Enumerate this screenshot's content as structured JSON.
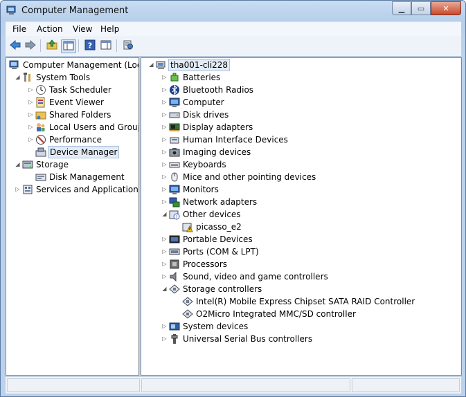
{
  "window": {
    "title": "Computer Management",
    "icon": "computer-management-icon"
  },
  "menu": [
    "File",
    "Action",
    "View",
    "Help"
  ],
  "toolbar": [
    "back-arrow-icon",
    "forward-arrow-icon",
    "up-folder-icon",
    "show-hide-tree-icon",
    "help-icon",
    "action-pane-icon",
    "properties-icon"
  ],
  "left_tree": [
    {
      "label": "Computer Management (Local",
      "icon": "computer-management-icon",
      "depth": 0,
      "expander": "none",
      "selected": false
    },
    {
      "label": "System Tools",
      "icon": "tools-icon",
      "depth": 1,
      "expander": "expanded",
      "selected": false
    },
    {
      "label": "Task Scheduler",
      "icon": "clock-icon",
      "depth": 2,
      "expander": "collapsed",
      "selected": false
    },
    {
      "label": "Event Viewer",
      "icon": "event-viewer-icon",
      "depth": 2,
      "expander": "collapsed",
      "selected": false
    },
    {
      "label": "Shared Folders",
      "icon": "shared-folder-icon",
      "depth": 2,
      "expander": "collapsed",
      "selected": false
    },
    {
      "label": "Local Users and Groups",
      "icon": "users-icon",
      "depth": 2,
      "expander": "collapsed",
      "selected": false
    },
    {
      "label": "Performance",
      "icon": "performance-icon",
      "depth": 2,
      "expander": "collapsed",
      "selected": false
    },
    {
      "label": "Device Manager",
      "icon": "device-manager-icon",
      "depth": 2,
      "expander": "none",
      "selected": true
    },
    {
      "label": "Storage",
      "icon": "storage-icon",
      "depth": 1,
      "expander": "expanded",
      "selected": false
    },
    {
      "label": "Disk Management",
      "icon": "disk-management-icon",
      "depth": 2,
      "expander": "none",
      "selected": false
    },
    {
      "label": "Services and Applications",
      "icon": "services-icon",
      "depth": 1,
      "expander": "collapsed",
      "selected": false
    }
  ],
  "device_tree": [
    {
      "label": "tha001-cli228",
      "icon": "computer-icon",
      "depth": 0,
      "expander": "expanded",
      "selected": true
    },
    {
      "label": "Batteries",
      "icon": "battery-icon",
      "depth": 1,
      "expander": "collapsed"
    },
    {
      "label": "Bluetooth Radios",
      "icon": "bluetooth-icon",
      "depth": 1,
      "expander": "collapsed"
    },
    {
      "label": "Computer",
      "icon": "monitor-icon",
      "depth": 1,
      "expander": "collapsed"
    },
    {
      "label": "Disk drives",
      "icon": "disk-drive-icon",
      "depth": 1,
      "expander": "collapsed"
    },
    {
      "label": "Display adapters",
      "icon": "display-adapter-icon",
      "depth": 1,
      "expander": "collapsed"
    },
    {
      "label": "Human Interface Devices",
      "icon": "hid-icon",
      "depth": 1,
      "expander": "collapsed"
    },
    {
      "label": "Imaging devices",
      "icon": "camera-icon",
      "depth": 1,
      "expander": "collapsed"
    },
    {
      "label": "Keyboards",
      "icon": "keyboard-icon",
      "depth": 1,
      "expander": "collapsed"
    },
    {
      "label": "Mice and other pointing devices",
      "icon": "mouse-icon",
      "depth": 1,
      "expander": "collapsed"
    },
    {
      "label": "Monitors",
      "icon": "monitor-icon",
      "depth": 1,
      "expander": "collapsed"
    },
    {
      "label": "Network adapters",
      "icon": "network-icon",
      "depth": 1,
      "expander": "collapsed"
    },
    {
      "label": "Other devices",
      "icon": "unknown-device-icon",
      "depth": 1,
      "expander": "expanded"
    },
    {
      "label": "picasso_e2",
      "icon": "warning-device-icon",
      "depth": 2,
      "expander": "none"
    },
    {
      "label": "Portable Devices",
      "icon": "portable-device-icon",
      "depth": 1,
      "expander": "collapsed"
    },
    {
      "label": "Ports (COM & LPT)",
      "icon": "port-icon",
      "depth": 1,
      "expander": "collapsed"
    },
    {
      "label": "Processors",
      "icon": "processor-icon",
      "depth": 1,
      "expander": "collapsed"
    },
    {
      "label": "Sound, video and game controllers",
      "icon": "speaker-icon",
      "depth": 1,
      "expander": "collapsed"
    },
    {
      "label": "Storage controllers",
      "icon": "storage-controller-icon",
      "depth": 1,
      "expander": "expanded"
    },
    {
      "label": "Intel(R) Mobile Express Chipset SATA RAID Controller",
      "icon": "storage-controller-icon",
      "depth": 2,
      "expander": "none"
    },
    {
      "label": "O2Micro Integrated MMC/SD controller",
      "icon": "storage-controller-icon",
      "depth": 2,
      "expander": "none"
    },
    {
      "label": "System devices",
      "icon": "system-device-icon",
      "depth": 1,
      "expander": "collapsed"
    },
    {
      "label": "Universal Serial Bus controllers",
      "icon": "usb-icon",
      "depth": 1,
      "expander": "collapsed"
    }
  ]
}
